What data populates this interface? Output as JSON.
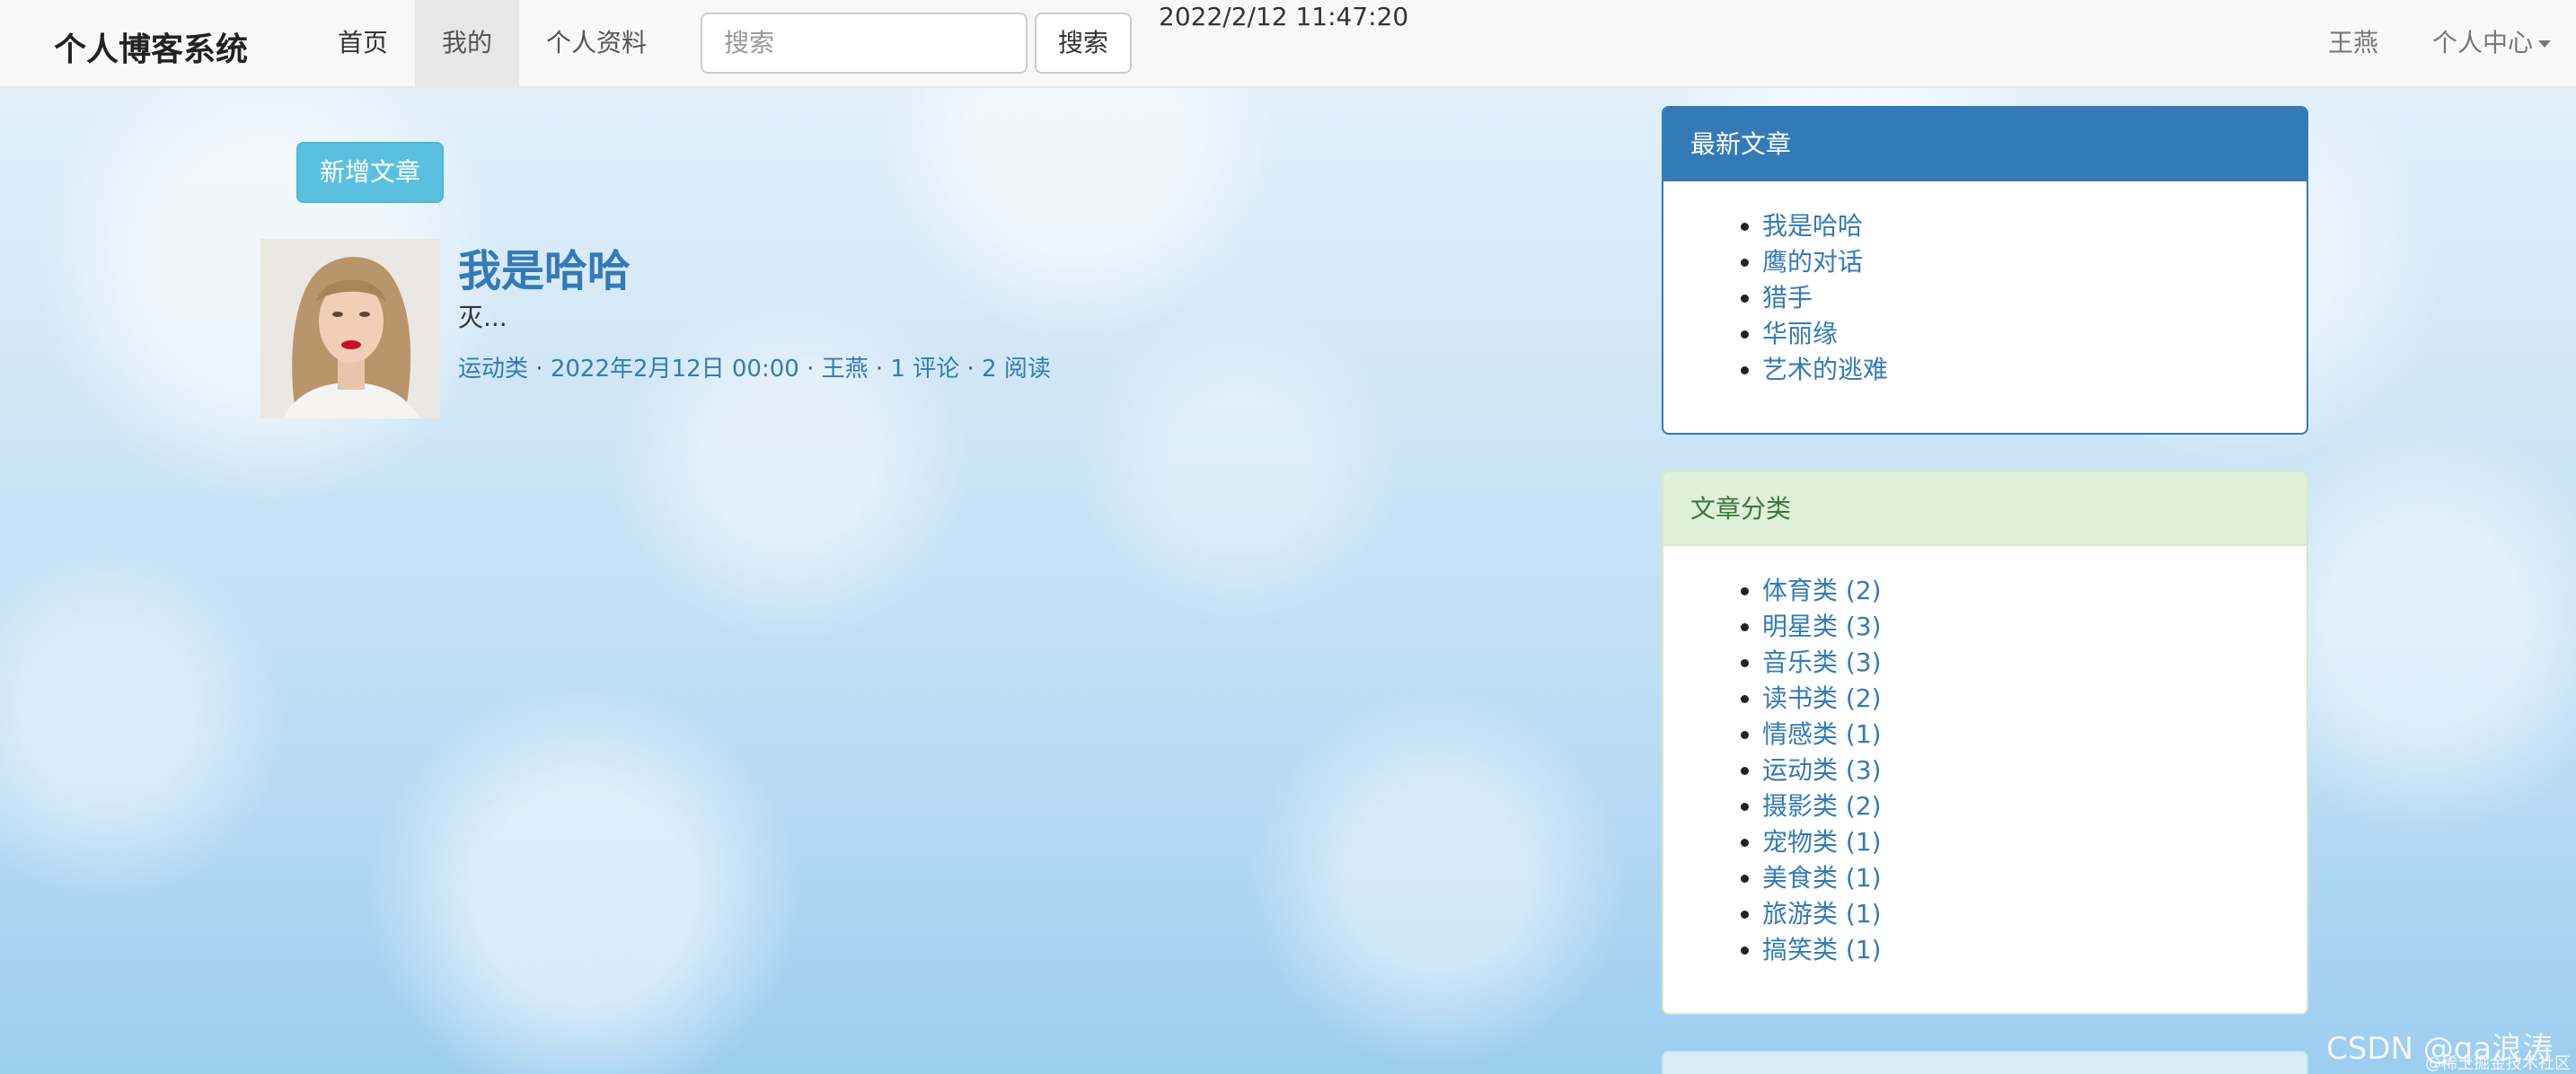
{
  "navbar": {
    "brand": "个人博客系统",
    "links": [
      "首页",
      "我的",
      "个人资料"
    ],
    "search_placeholder": "搜索",
    "search_button": "搜索",
    "clock": "2022/2/12 11:47:20",
    "user": "王燕",
    "center": "个人中心"
  },
  "main": {
    "add_button": "新增文章",
    "article": {
      "title": "我是哈哈",
      "summary": "灭...",
      "meta": {
        "category": "运动类",
        "date": "2022年2月12日 00:00",
        "author": "王燕",
        "comments": "1 评论",
        "reads": "2 阅读"
      }
    }
  },
  "sidebar": {
    "latest": {
      "title": "最新文章",
      "items": [
        "我是哈哈",
        "鹰的对话",
        "猎手",
        "华丽缘",
        "艺术的逃难"
      ]
    },
    "categories": {
      "title": "文章分类",
      "items": [
        "体育类 (2)",
        "明星类 (3)",
        "音乐类 (3)",
        "读书类 (2)",
        "情感类 (1)",
        "运动类 (3)",
        "摄影类 (2)",
        "宠物类 (1)",
        "美食类 (1)",
        "旅游类 (1)",
        "搞笑类 (1)"
      ]
    }
  },
  "watermark": {
    "main": "CSDN @qa浪涛",
    "sub": "@稀土掘金技术社区"
  },
  "colors": {
    "link": "#337ab7",
    "primary_panel": "#337ab7",
    "success_panel_bg": "#dff0d8",
    "info_button": "#5bc0de"
  }
}
